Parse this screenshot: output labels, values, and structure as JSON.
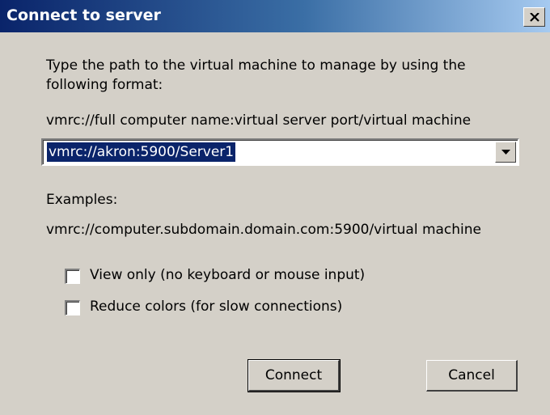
{
  "dialog": {
    "title": "Connect to server",
    "close_glyph": "close-icon"
  },
  "instructions": {
    "line1": "Type the path to the virtual machine to manage by using the",
    "line2": "following format:",
    "format": "vmrc://full computer name:virtual server port/virtual machine"
  },
  "path_combo": {
    "value": "vmrc://akron:5900/Server1",
    "arrow_icon": "chevron-down-icon"
  },
  "examples": {
    "label": "Examples:",
    "example": "vmrc://computer.subdomain.domain.com:5900/virtual machine"
  },
  "options": {
    "view_only": {
      "label": "View only (no keyboard or mouse input)",
      "checked": false
    },
    "reduce_colors": {
      "label": "Reduce colors (for slow connections)",
      "checked": false
    }
  },
  "buttons": {
    "connect": "Connect",
    "cancel": "Cancel"
  }
}
